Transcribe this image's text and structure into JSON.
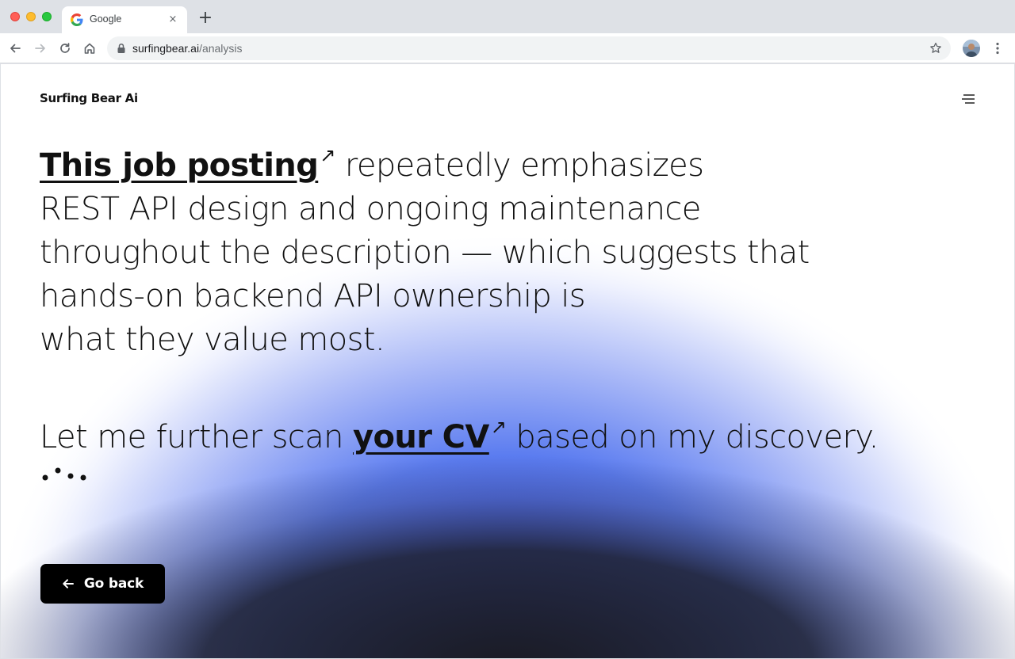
{
  "browser": {
    "tab_title": "Google",
    "tab_close_glyph": "×",
    "new_tab_glyph": "+",
    "url_host": "surfingbear.ai",
    "url_path": "/analysis"
  },
  "page": {
    "brand": "Surfing Bear Ai",
    "headline": {
      "link1": "This job posting",
      "arrow": "↗",
      "line1_rest": " repeatedly emphasizes",
      "line2": "REST API design and ongoing maintenance",
      "line3": "throughout the description — which suggests that",
      "line4": "hands-on backend API ownership is",
      "line5": "what they value most."
    },
    "second": {
      "prefix": "Let me further scan ",
      "link2": "your CV",
      "suffix": " based on my discovery."
    },
    "go_back_label": "Go back"
  },
  "colors": {
    "glow_blue": "#5b7cf0",
    "glow_dark": "#1c1e2a",
    "button_bg": "#000000"
  }
}
